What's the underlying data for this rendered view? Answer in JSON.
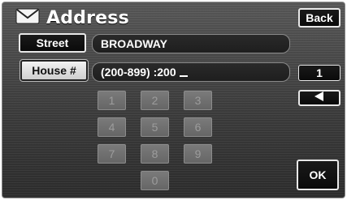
{
  "header": {
    "title": "Address",
    "icon": "envelope-icon",
    "back_label": "Back"
  },
  "street": {
    "button_label": "Street",
    "value": "BROADWAY"
  },
  "house": {
    "button_label": "House #",
    "value": "(200-899) :200"
  },
  "right_panel": {
    "count_label": "1",
    "backspace_icon": "left-arrow-icon",
    "ok_label": "OK"
  },
  "keypad": {
    "keys": [
      "1",
      "2",
      "3",
      "4",
      "5",
      "6",
      "7",
      "8",
      "9",
      "0"
    ]
  },
  "colors": {
    "background": "#3c3c3c",
    "button_dark": "#0a0a0a",
    "button_light": "#e6e6e6",
    "key_disabled": "#6e6e6e"
  }
}
